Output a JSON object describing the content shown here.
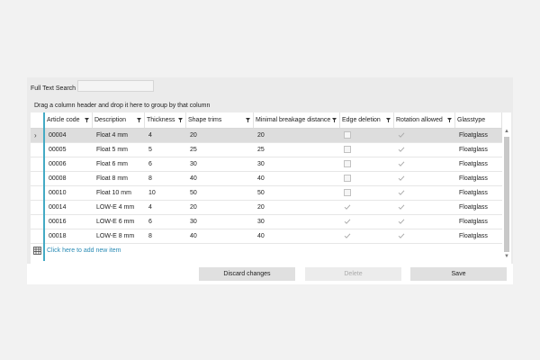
{
  "search": {
    "label": "Full Text Search",
    "value": "",
    "placeholder": ""
  },
  "group_hint": "Drag a column header and drop it here to group by that column",
  "columns": [
    {
      "label": "Article code"
    },
    {
      "label": "Description"
    },
    {
      "label": "Thickness"
    },
    {
      "label": "Shape trims"
    },
    {
      "label": "Minimal breakage distance"
    },
    {
      "label": "Edge deletion"
    },
    {
      "label": "Rotation allowed"
    },
    {
      "label": "Glasstype"
    }
  ],
  "rows": [
    {
      "code": "00004",
      "description": "Float 4 mm",
      "thickness": "4",
      "shape_trims": "20",
      "min_breakage": "20",
      "edge_deletion": false,
      "rotation_allowed": true,
      "glasstype": "Floatglass"
    },
    {
      "code": "00005",
      "description": "Float 5 mm",
      "thickness": "5",
      "shape_trims": "25",
      "min_breakage": "25",
      "edge_deletion": false,
      "rotation_allowed": true,
      "glasstype": "Floatglass"
    },
    {
      "code": "00006",
      "description": "Float 6 mm",
      "thickness": "6",
      "shape_trims": "30",
      "min_breakage": "30",
      "edge_deletion": false,
      "rotation_allowed": true,
      "glasstype": "Floatglass"
    },
    {
      "code": "00008",
      "description": "Float 8 mm",
      "thickness": "8",
      "shape_trims": "40",
      "min_breakage": "40",
      "edge_deletion": false,
      "rotation_allowed": true,
      "glasstype": "Floatglass"
    },
    {
      "code": "00010",
      "description": "Float 10 mm",
      "thickness": "10",
      "shape_trims": "50",
      "min_breakage": "50",
      "edge_deletion": false,
      "rotation_allowed": true,
      "glasstype": "Floatglass"
    },
    {
      "code": "00014",
      "description": "LOW-E 4 mm",
      "thickness": "4",
      "shape_trims": "20",
      "min_breakage": "20",
      "edge_deletion": true,
      "rotation_allowed": true,
      "glasstype": "Floatglass"
    },
    {
      "code": "00016",
      "description": "LOW-E 6 mm",
      "thickness": "6",
      "shape_trims": "30",
      "min_breakage": "30",
      "edge_deletion": true,
      "rotation_allowed": true,
      "glasstype": "Floatglass"
    },
    {
      "code": "00018",
      "description": "LOW-E 8 mm",
      "thickness": "8",
      "shape_trims": "40",
      "min_breakage": "40",
      "edge_deletion": true,
      "rotation_allowed": true,
      "glasstype": "Floatglass"
    }
  ],
  "selected_row_index": 0,
  "new_item_label": "Click here to add new item",
  "buttons": {
    "discard": "Discard changes",
    "delete": "Delete",
    "save": "Save"
  },
  "colors": {
    "accent": "#44aac4",
    "link": "#2a8bb5",
    "selected_row": "#dddddd"
  }
}
